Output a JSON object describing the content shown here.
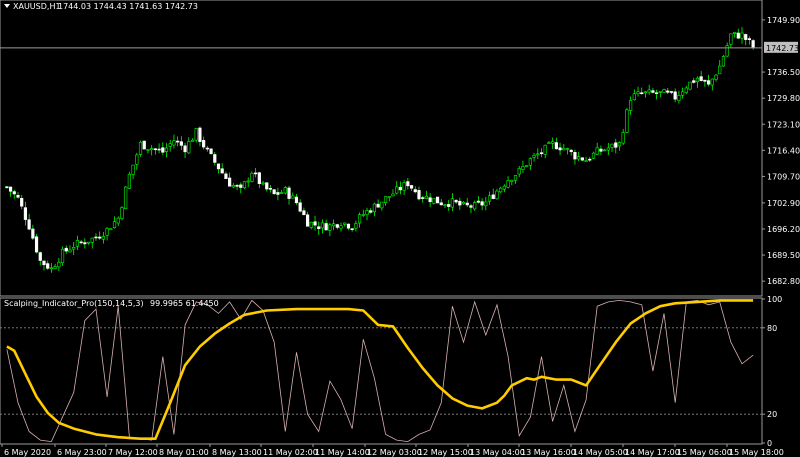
{
  "main_chart": {
    "symbol_timeframe": "XAUUSD,H1",
    "ohlc_text": "1744.03 1744.43 1741.63 1742.73",
    "current_price": "1742.73",
    "price_labels": [
      "1749.90",
      "1736.50",
      "1729.80",
      "1723.10",
      "1716.40",
      "1709.70",
      "1702.90",
      "1696.20",
      "1689.50",
      "1682.80"
    ],
    "bull_color": "#00ff00",
    "bear_color": "#ffffff",
    "price_range": [
      1679.5,
      1754.5
    ]
  },
  "indicator": {
    "header": "Scalping_Indicator_Pro(150,14,5,3)",
    "values_text": "99.9965 61.4450",
    "levels": [
      "100",
      "80",
      "20",
      "0"
    ],
    "main_line_color": "#ffcc00",
    "signal_line_color": "#d8b0b0"
  },
  "time_axis": {
    "labels": [
      "6 May 2020",
      "6 May 23:00",
      "7 May 12:00",
      "8 May 01:00",
      "8 May 13:00",
      "11 May 02:00",
      "11 May 14:00",
      "12 May 03:00",
      "12 May 15:00",
      "13 May 04:00",
      "13 May 16:00",
      "14 May 05:00",
      "14 May 17:00",
      "15 May 06:00",
      "15 May 18:00"
    ]
  },
  "chart_data": [
    {
      "type": "candlestick",
      "title": "XAUUSD,H1",
      "ylim": [
        1679.5,
        1754.5
      ],
      "y_ticks": [
        1749.9,
        1736.5,
        1729.8,
        1723.1,
        1716.4,
        1709.7,
        1702.9,
        1696.2,
        1689.5,
        1682.8
      ],
      "last_price": 1742.73,
      "x_labels": [
        "6 May 2020",
        "6 May 23:00",
        "7 May 12:00",
        "8 May 01:00",
        "8 May 13:00",
        "11 May 02:00",
        "11 May 14:00",
        "12 May 03:00",
        "12 May 15:00",
        "13 May 04:00",
        "13 May 16:00",
        "14 May 05:00",
        "14 May 17:00",
        "15 May 06:00",
        "15 May 18:00"
      ],
      "close_path": [
        [
          0,
          1707
        ],
        [
          3,
          1704
        ],
        [
          6,
          1697
        ],
        [
          9,
          1688
        ],
        [
          12,
          1686
        ],
        [
          15,
          1690
        ],
        [
          18,
          1692
        ],
        [
          21,
          1693
        ],
        [
          24,
          1694
        ],
        [
          27,
          1696
        ],
        [
          30,
          1699
        ],
        [
          33,
          1710
        ],
        [
          36,
          1718
        ],
        [
          39,
          1717
        ],
        [
          42,
          1716
        ],
        [
          45,
          1719
        ],
        [
          48,
          1717
        ],
        [
          51,
          1721
        ],
        [
          54,
          1716
        ],
        [
          57,
          1712
        ],
        [
          60,
          1708
        ],
        [
          63,
          1706
        ],
        [
          66,
          1711
        ],
        [
          69,
          1707
        ],
        [
          72,
          1705
        ],
        [
          75,
          1706
        ],
        [
          78,
          1703
        ],
        [
          81,
          1698
        ],
        [
          84,
          1697
        ],
        [
          87,
          1697
        ],
        [
          90,
          1698
        ],
        [
          93,
          1697
        ],
        [
          96,
          1700
        ],
        [
          99,
          1702
        ],
        [
          102,
          1704
        ],
        [
          105,
          1706
        ],
        [
          108,
          1708
        ],
        [
          111,
          1705
        ],
        [
          114,
          1704
        ],
        [
          117,
          1703
        ],
        [
          120,
          1703
        ],
        [
          123,
          1702
        ],
        [
          126,
          1702
        ],
        [
          129,
          1703
        ],
        [
          132,
          1706
        ],
        [
          135,
          1709
        ],
        [
          138,
          1711
        ],
        [
          141,
          1714
        ],
        [
          144,
          1716
        ],
        [
          147,
          1718
        ],
        [
          150,
          1717
        ],
        [
          153,
          1715
        ],
        [
          156,
          1714
        ],
        [
          159,
          1716
        ],
        [
          162,
          1717
        ],
        [
          165,
          1718
        ],
        [
          168,
          1730
        ],
        [
          171,
          1731
        ],
        [
          174,
          1731
        ],
        [
          177,
          1731
        ],
        [
          180,
          1730
        ],
        [
          183,
          1733
        ],
        [
          186,
          1735
        ],
        [
          189,
          1733
        ],
        [
          192,
          1738
        ],
        [
          195,
          1746
        ],
        [
          198,
          1746
        ],
        [
          201,
          1743
        ]
      ]
    },
    {
      "type": "line",
      "title": "Scalping_Indicator_Pro(150,14,5,3)",
      "ylim": [
        0,
        100
      ],
      "levels": [
        100,
        80,
        20,
        0
      ],
      "series": [
        {
          "name": "99.9965",
          "values": [
            [
              0,
              67
            ],
            [
              2,
              64
            ],
            [
              5,
              48
            ],
            [
              8,
              32
            ],
            [
              11,
              21
            ],
            [
              14,
              14
            ],
            [
              18,
              10
            ],
            [
              24,
              6
            ],
            [
              30,
              4
            ],
            [
              36,
              3
            ],
            [
              40,
              3
            ],
            [
              44,
              28
            ],
            [
              48,
              54
            ],
            [
              52,
              67
            ],
            [
              56,
              76
            ],
            [
              60,
              83
            ],
            [
              64,
              89
            ],
            [
              70,
              92
            ],
            [
              78,
              93
            ],
            [
              86,
              93
            ],
            [
              92,
              93
            ],
            [
              96,
              92
            ],
            [
              100,
              82
            ],
            [
              104,
              81
            ],
            [
              108,
              66
            ],
            [
              112,
              52
            ],
            [
              116,
              40
            ],
            [
              120,
              31
            ],
            [
              124,
              26
            ],
            [
              128,
              24
            ],
            [
              132,
              28
            ],
            [
              134,
              33
            ],
            [
              136,
              40
            ],
            [
              140,
              45
            ],
            [
              142,
              44
            ],
            [
              144,
              46
            ],
            [
              148,
              44
            ],
            [
              152,
              44
            ],
            [
              156,
              40
            ],
            [
              160,
              55
            ],
            [
              164,
              70
            ],
            [
              168,
              83
            ],
            [
              172,
              90
            ],
            [
              176,
              95
            ],
            [
              180,
              97
            ],
            [
              186,
              98
            ],
            [
              192,
              99
            ],
            [
              198,
              99
            ],
            [
              201,
              99
            ]
          ]
        },
        {
          "name": "61.4450",
          "values": [
            [
              0,
              65
            ],
            [
              3,
              28
            ],
            [
              6,
              8
            ],
            [
              9,
              2
            ],
            [
              12,
              1
            ],
            [
              15,
              18
            ],
            [
              18,
              35
            ],
            [
              21,
              85
            ],
            [
              24,
              93
            ],
            [
              27,
              32
            ],
            [
              30,
              95
            ],
            [
              33,
              4
            ],
            [
              36,
              3
            ],
            [
              39,
              2
            ],
            [
              42,
              60
            ],
            [
              45,
              6
            ],
            [
              48,
              82
            ],
            [
              51,
              98
            ],
            [
              54,
              96
            ],
            [
              57,
              90
            ],
            [
              60,
              98
            ],
            [
              63,
              86
            ],
            [
              66,
              99
            ],
            [
              69,
              92
            ],
            [
              72,
              70
            ],
            [
              75,
              8
            ],
            [
              78,
              63
            ],
            [
              81,
              20
            ],
            [
              84,
              8
            ],
            [
              87,
              43
            ],
            [
              90,
              30
            ],
            [
              93,
              10
            ],
            [
              96,
              72
            ],
            [
              99,
              45
            ],
            [
              102,
              6
            ],
            [
              105,
              2
            ],
            [
              108,
              1
            ],
            [
              111,
              6
            ],
            [
              114,
              9
            ],
            [
              117,
              28
            ],
            [
              120,
              95
            ],
            [
              123,
              70
            ],
            [
              126,
              98
            ],
            [
              129,
              75
            ],
            [
              132,
              96
            ],
            [
              135,
              60
            ],
            [
              138,
              5
            ],
            [
              141,
              18
            ],
            [
              144,
              60
            ],
            [
              147,
              15
            ],
            [
              150,
              40
            ],
            [
              153,
              8
            ],
            [
              156,
              30
            ],
            [
              159,
              95
            ],
            [
              162,
              98
            ],
            [
              165,
              99
            ],
            [
              168,
              98
            ],
            [
              171,
              96
            ],
            [
              174,
              50
            ],
            [
              177,
              90
            ],
            [
              180,
              28
            ],
            [
              183,
              98
            ],
            [
              186,
              99
            ],
            [
              189,
              96
            ],
            [
              192,
              98
            ],
            [
              195,
              70
            ],
            [
              198,
              55
            ],
            [
              201,
              61
            ]
          ]
        }
      ]
    }
  ]
}
